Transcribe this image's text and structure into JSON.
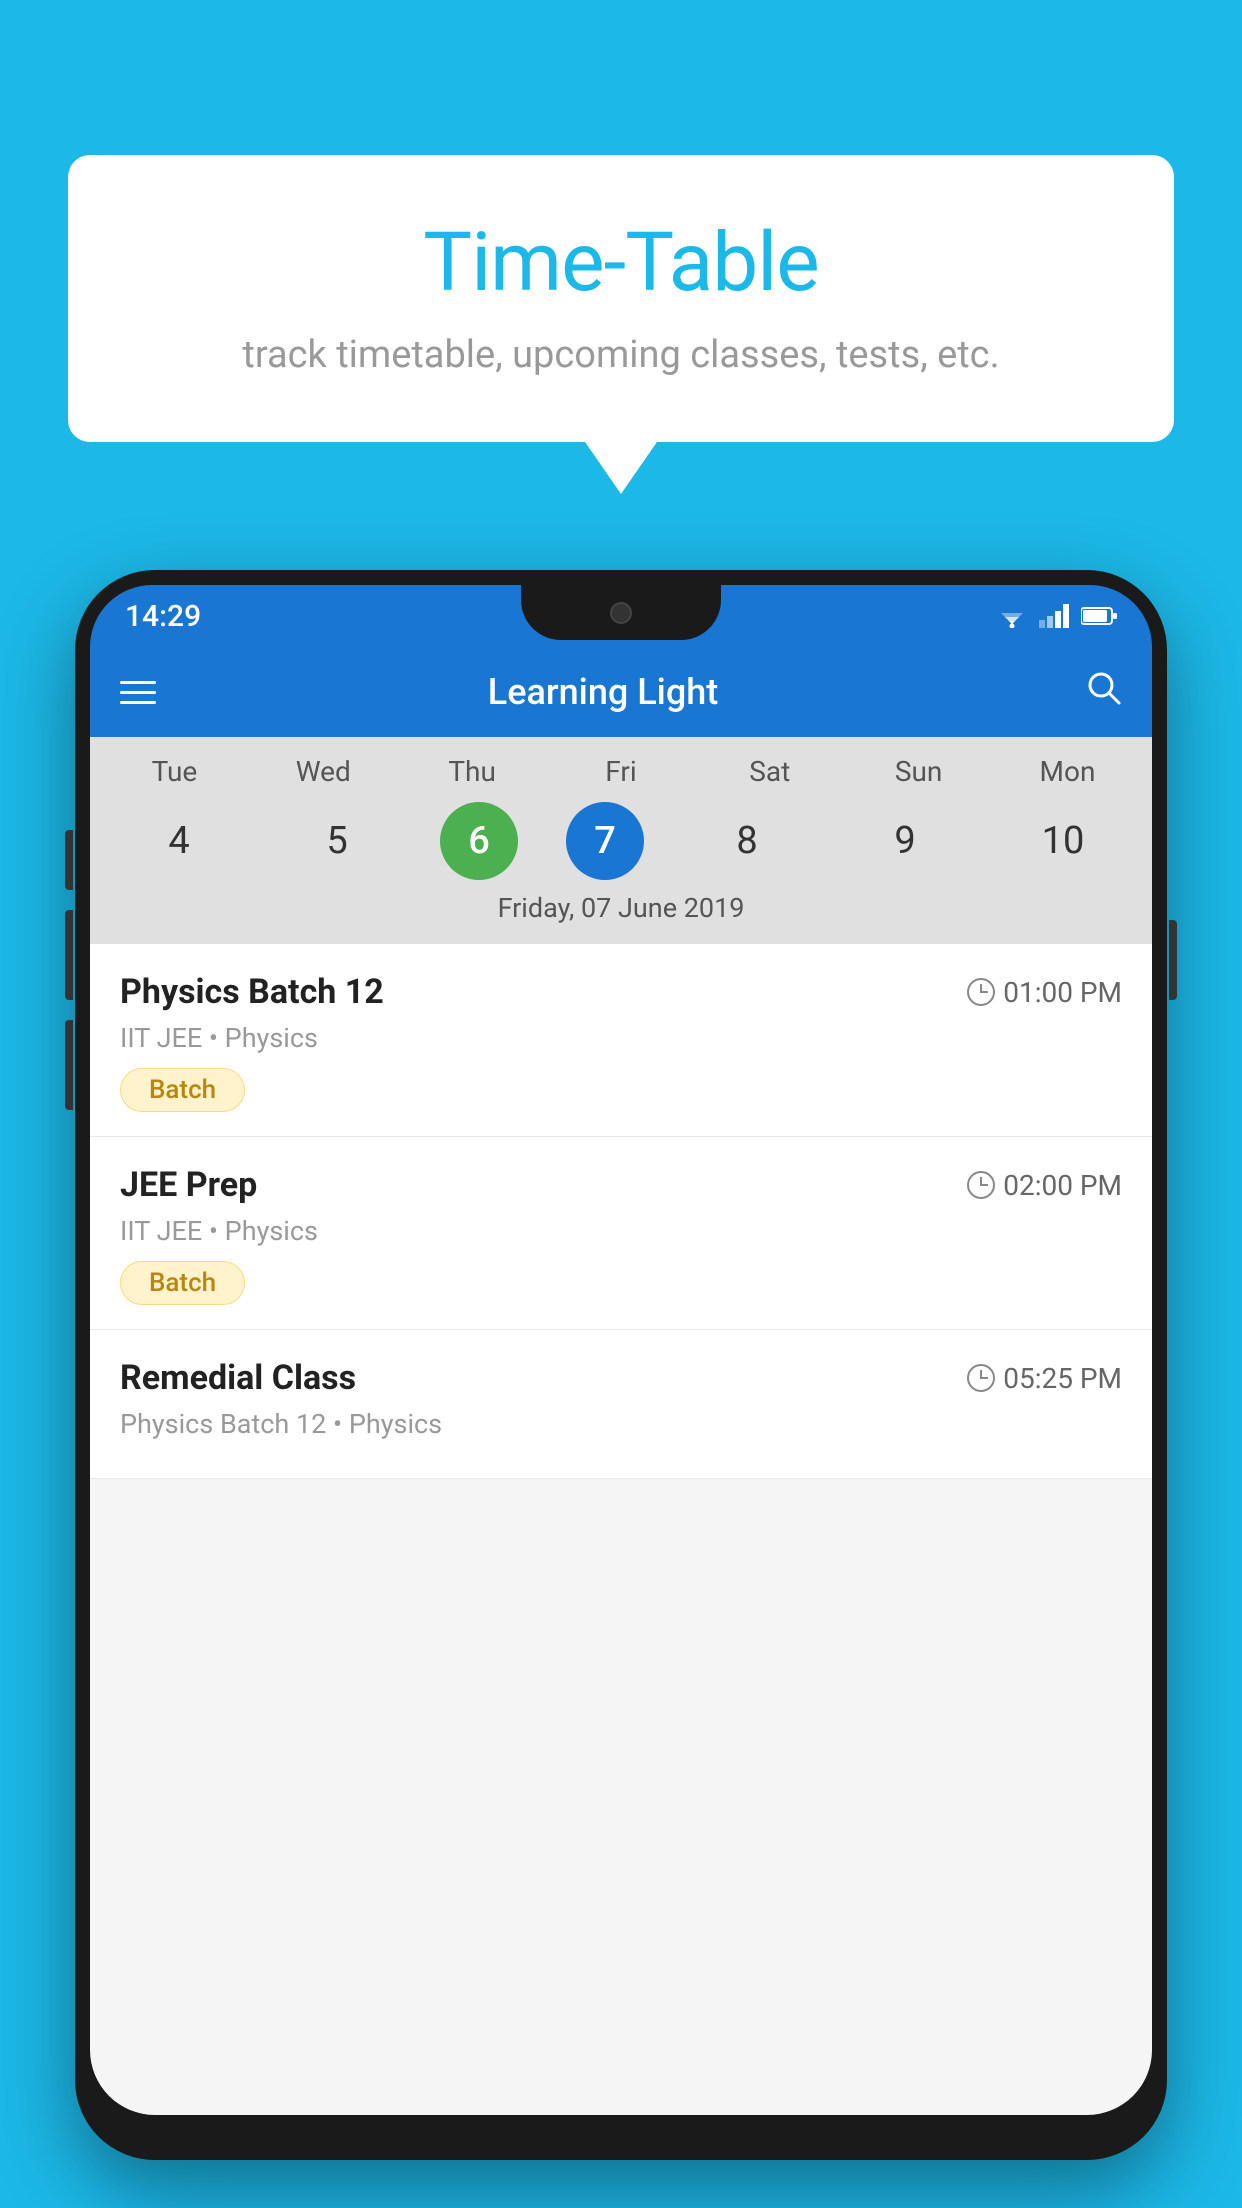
{
  "background": {
    "color": "#1CB8E8"
  },
  "bubble": {
    "title": "Time-Table",
    "subtitle": "track timetable, upcoming classes, tests, etc."
  },
  "phone": {
    "status_bar": {
      "time": "14:29"
    },
    "app_bar": {
      "title": "Learning Light"
    },
    "calendar": {
      "days": [
        {
          "label": "Tue",
          "number": "4"
        },
        {
          "label": "Wed",
          "number": "5"
        },
        {
          "label": "Thu",
          "number": "6",
          "state": "today"
        },
        {
          "label": "Fri",
          "number": "7",
          "state": "selected"
        },
        {
          "label": "Sat",
          "number": "8"
        },
        {
          "label": "Sun",
          "number": "9"
        },
        {
          "label": "Mon",
          "number": "10"
        }
      ],
      "selected_date": "Friday, 07 June 2019"
    },
    "classes": [
      {
        "name": "Physics Batch 12",
        "time": "01:00 PM",
        "subtitle": "IIT JEE • Physics",
        "tag": "Batch"
      },
      {
        "name": "JEE Prep",
        "time": "02:00 PM",
        "subtitle": "IIT JEE • Physics",
        "tag": "Batch"
      },
      {
        "name": "Remedial Class",
        "time": "05:25 PM",
        "subtitle": "Physics Batch 12 • Physics",
        "tag": ""
      }
    ]
  }
}
